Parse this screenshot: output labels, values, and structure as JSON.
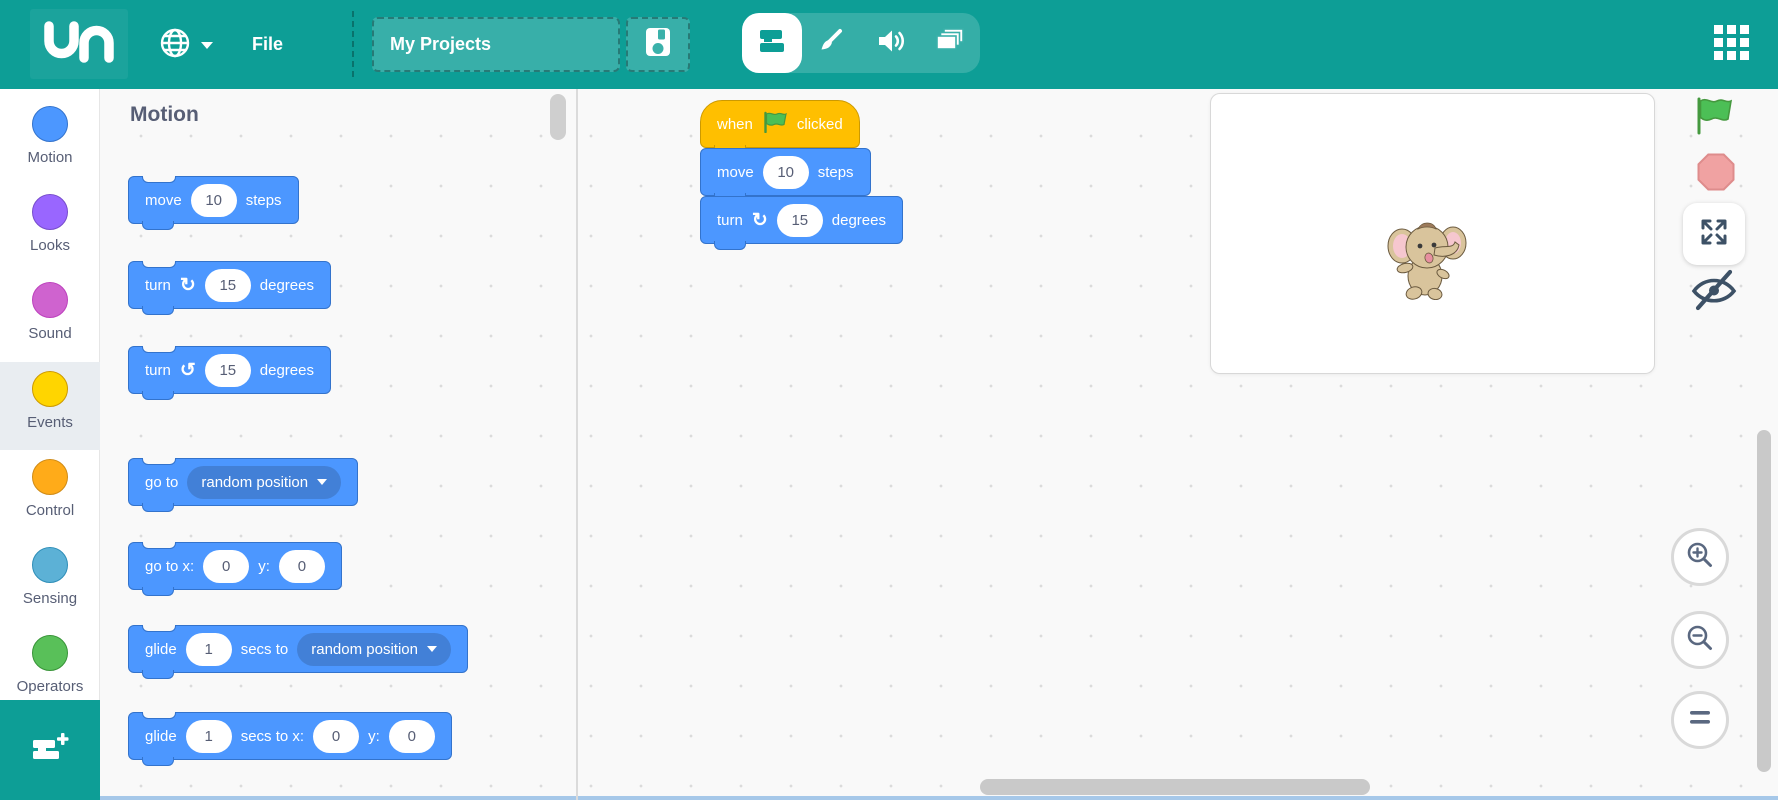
{
  "topbar": {
    "file_menu": "File",
    "project_name": "My Projects",
    "colors": {
      "bar": "#0D9E96",
      "control_light": "#3AB1AA"
    }
  },
  "categories": [
    {
      "label": "Motion",
      "color": "#4C97FF",
      "border": "#3373CC",
      "selected": false
    },
    {
      "label": "Looks",
      "color": "#9966FF",
      "border": "#774DCB",
      "selected": false
    },
    {
      "label": "Sound",
      "color": "#CF63CF",
      "border": "#BD42BD",
      "selected": false
    },
    {
      "label": "Events",
      "color": "#FFD500",
      "border": "#CC9900",
      "selected": true
    },
    {
      "label": "Control",
      "color": "#FFAB19",
      "border": "#CF8B17",
      "selected": false
    },
    {
      "label": "Sensing",
      "color": "#5CB1D6",
      "border": "#2E8EB8",
      "selected": false
    },
    {
      "label": "Operators",
      "color": "#59C059",
      "border": "#389438",
      "selected": false
    }
  ],
  "palette": {
    "header": "Motion",
    "blocks": [
      {
        "name": "move-steps",
        "t1": "move",
        "v1": "10",
        "t2": "steps"
      },
      {
        "name": "turn-clockwise",
        "t1": "turn",
        "icon": "↻",
        "v1": "15",
        "t2": "degrees"
      },
      {
        "name": "turn-counterclockwise",
        "t1": "turn",
        "icon": "↺",
        "v1": "15",
        "t2": "degrees"
      },
      {
        "name": "goto-menu",
        "t1": "go to",
        "menu": "random position"
      },
      {
        "name": "goto-xy",
        "t1": "go to x:",
        "v1": "0",
        "t2": "y:",
        "v2": "0"
      },
      {
        "name": "glide-menu",
        "t1": "glide",
        "v1": "1",
        "t2": "secs to",
        "menu": "random position"
      },
      {
        "name": "glide-xy",
        "t1": "glide",
        "v1": "1",
        "t2": "secs to x:",
        "v2": "0",
        "t3": "y:",
        "v3": "0"
      }
    ]
  },
  "script": {
    "hat": {
      "t1": "when",
      "t2": "clicked"
    },
    "blocks": [
      {
        "name": "move-steps",
        "t1": "move",
        "v1": "10",
        "t2": "steps"
      },
      {
        "name": "turn-clockwise",
        "t1": "turn",
        "icon": "↻",
        "v1": "15",
        "t2": "degrees"
      }
    ]
  },
  "block_colors": {
    "motion": "#4C97FF",
    "motion_border": "#3373CC",
    "motion_menu": "#4280D7",
    "events": "#FFBF00",
    "events_border": "#CC9900",
    "input_text": "#575E75"
  },
  "stage": {
    "sprite": "baby-elephant"
  },
  "icons": {
    "topbar": [
      "globe-icon",
      "caret-down-icon",
      "save-icon",
      "code-blocks-icon",
      "paintbrush-icon",
      "speaker-icon",
      "backdrops-icon",
      "apps-grid-icon"
    ],
    "stage_controls": [
      "green-flag-icon",
      "stop-sign-icon",
      "fullscreen-icon",
      "hide-eye-icon"
    ],
    "zoom_controls": [
      "zoom-in-icon",
      "zoom-out-icon",
      "zoom-reset-icon"
    ]
  }
}
